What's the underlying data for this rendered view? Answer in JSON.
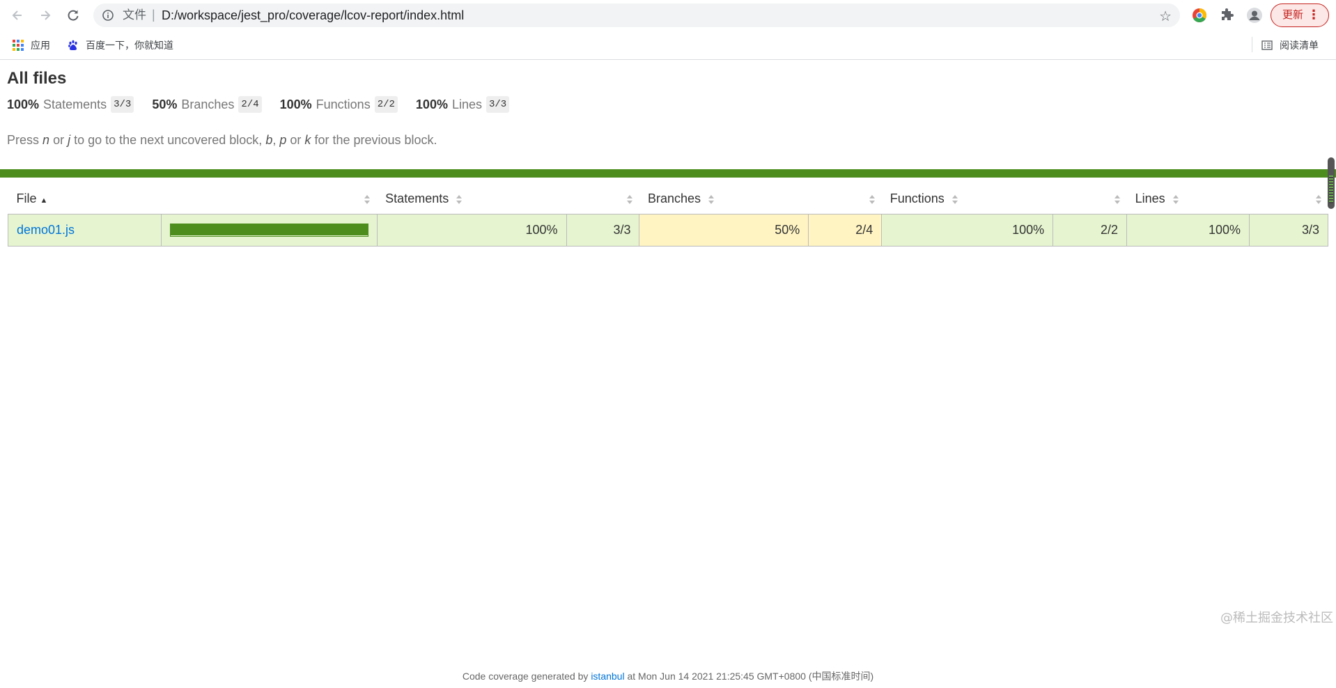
{
  "browser": {
    "scheme_label": "文件",
    "url": "D:/workspace/jest_pro/coverage/lcov-report/index.html",
    "update_label": "更新",
    "bookmarks": [
      {
        "label": "应用",
        "icon": "apps-grid-icon"
      },
      {
        "label": "百度一下，你就知道",
        "icon": "baidu-paw-icon"
      }
    ],
    "reading_list_label": "阅读清单"
  },
  "report": {
    "title": "All files",
    "summary": [
      {
        "pct": "100%",
        "label": "Statements",
        "frac": "3/3"
      },
      {
        "pct": "50%",
        "label": "Branches",
        "frac": "2/4"
      },
      {
        "pct": "100%",
        "label": "Functions",
        "frac": "2/2"
      },
      {
        "pct": "100%",
        "label": "Lines",
        "frac": "3/3"
      }
    ],
    "hint": {
      "press": "Press",
      "n": "n",
      "or1": "or",
      "j": "j",
      "mid": "to go to the next uncovered block,",
      "b": "b",
      "comma": ",",
      "p": "p",
      "or2": "or",
      "k": "k",
      "end": "for the previous block."
    },
    "columns": [
      "File",
      "Statements",
      "Branches",
      "Functions",
      "Lines"
    ],
    "rows": [
      {
        "file": "demo01.js",
        "coverage_fraction": 1.0,
        "statements_pct": "100%",
        "statements_frac": "3/3",
        "branches_pct": "50%",
        "branches_frac": "2/4",
        "functions_pct": "100%",
        "functions_frac": "2/2",
        "lines_pct": "100%",
        "lines_frac": "3/3"
      }
    ],
    "footer": {
      "prefix": "Code coverage generated by",
      "link": "istanbul",
      "suffix": "at Mon Jun 14 2021 21:25:45 GMT+0800 (中国标准时间)"
    }
  },
  "colors": {
    "high_bg": "#e6f5d0",
    "medium_bg": "#fff4c2",
    "high_bar": "#4d8d1e",
    "link": "#0074d9"
  },
  "watermark": "@稀土掘金技术社区"
}
